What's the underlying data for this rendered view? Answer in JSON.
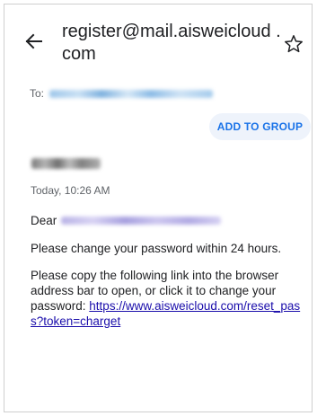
{
  "email": {
    "subject": "register@mail.aisweicloud .com",
    "to_label": "To:",
    "add_to_group_label": "ADD TO GROUP",
    "date": "Today, 10:26 AM",
    "greeting": "Dear",
    "body_paragraph_1": "Please change your password within 24 hours.",
    "body_paragraph_2": "Please copy the following link into the browser address bar to open, or click it to change your password:",
    "reset_link": "https://www.aisweicloud.com/reset_pass?token=charget"
  },
  "icons": {
    "back": "arrow-left-icon",
    "star": "star-outline-icon"
  },
  "colors": {
    "accent": "#1a73e8",
    "link": "#1a0dab",
    "chip_background": "#eef3fb",
    "text_primary": "#202124",
    "text_secondary": "#5f6368"
  }
}
